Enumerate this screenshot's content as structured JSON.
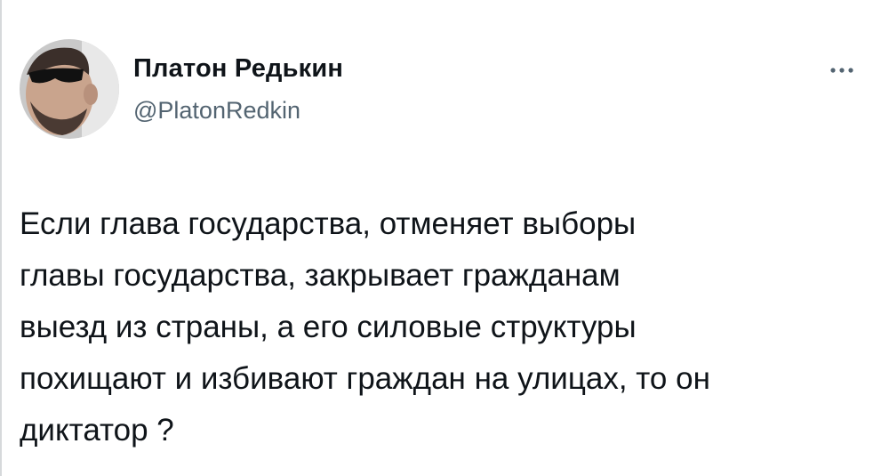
{
  "tweet": {
    "author": {
      "display_name": "Платон Редькин",
      "handle": "@PlatonRedkin",
      "avatar_icon": "user-avatar-photo"
    },
    "more_icon": "more-options-icon",
    "text": "Если глава государства, отменяет выборы\nглавы государства, закрывает гражданам\nвыезд из страны, а его силовые структуры\nпохищают и избивают граждан на улицах, то он\nдиктатор ?"
  },
  "colors": {
    "text": "#0f1419",
    "secondary_text": "#536471",
    "background": "#ffffff"
  }
}
